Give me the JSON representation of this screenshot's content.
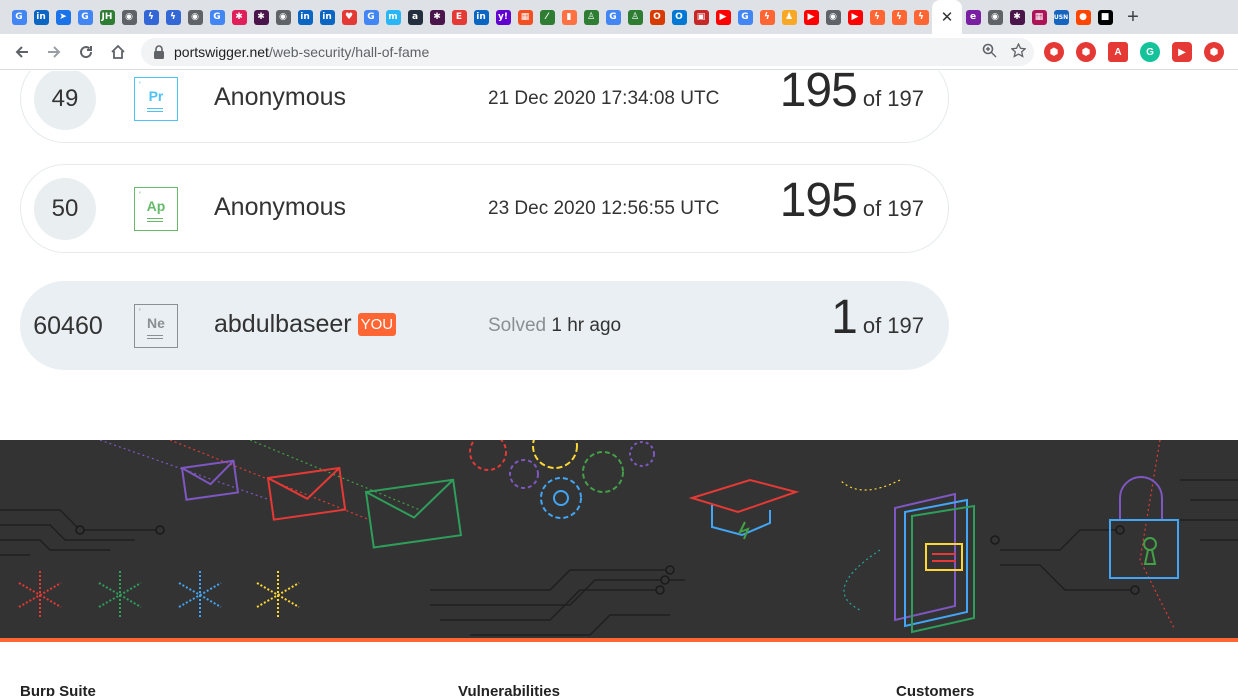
{
  "browser": {
    "favicons": [
      {
        "icon": "google-icon",
        "glyph": "G",
        "color": "#4285f4"
      },
      {
        "icon": "linkedin-icon",
        "glyph": "in",
        "color": "#0a66c2"
      },
      {
        "icon": "arrow-icon",
        "glyph": "➤",
        "color": "#1a73e8"
      },
      {
        "icon": "google-icon",
        "glyph": "G",
        "color": "#4285f4"
      },
      {
        "icon": "jh-icon",
        "glyph": "JH",
        "color": "#2e7d32"
      },
      {
        "icon": "globe-icon",
        "glyph": "◉",
        "color": "#5f6368"
      },
      {
        "icon": "zap-icon",
        "glyph": "ϟ",
        "color": "#3367d6"
      },
      {
        "icon": "zap-icon",
        "glyph": "ϟ",
        "color": "#3367d6"
      },
      {
        "icon": "globe-icon",
        "glyph": "◉",
        "color": "#5f6368"
      },
      {
        "icon": "google-icon",
        "glyph": "G",
        "color": "#4285f4"
      },
      {
        "icon": "slack-icon",
        "glyph": "✱",
        "color": "#e01e5a"
      },
      {
        "icon": "slack-icon",
        "glyph": "✱",
        "color": "#4a154b"
      },
      {
        "icon": "globe-icon",
        "glyph": "◉",
        "color": "#5f6368"
      },
      {
        "icon": "linkedin-icon",
        "glyph": "in",
        "color": "#0a66c2"
      },
      {
        "icon": "linkedin-icon",
        "glyph": "in",
        "color": "#0a66c2"
      },
      {
        "icon": "heart-icon",
        "glyph": "♥",
        "color": "#e53935"
      },
      {
        "icon": "google-icon",
        "glyph": "G",
        "color": "#4285f4"
      },
      {
        "icon": "m-icon",
        "glyph": "m",
        "color": "#29b6f6"
      },
      {
        "icon": "amazon-icon",
        "glyph": "a",
        "color": "#232f3e"
      },
      {
        "icon": "slack-icon",
        "glyph": "✱",
        "color": "#4a154b"
      },
      {
        "icon": "e-icon",
        "glyph": "E",
        "color": "#e53935"
      },
      {
        "icon": "linkedin-icon",
        "glyph": "in",
        "color": "#0a66c2"
      },
      {
        "icon": "yahoo-icon",
        "glyph": "y!",
        "color": "#6001d2"
      },
      {
        "icon": "windows-icon",
        "glyph": "▦",
        "color": "#f25022"
      },
      {
        "icon": "slash-icon",
        "glyph": "⁄",
        "color": "#2e7d32"
      },
      {
        "icon": "bookmark-icon",
        "glyph": "▮",
        "color": "#ff7043"
      },
      {
        "icon": "person-icon",
        "glyph": "♙",
        "color": "#2e7d32"
      },
      {
        "icon": "google-icon",
        "glyph": "G",
        "color": "#4285f4"
      },
      {
        "icon": "person-icon",
        "glyph": "♙",
        "color": "#2e7d32"
      },
      {
        "icon": "office-icon",
        "glyph": "O",
        "color": "#d83b01"
      },
      {
        "icon": "outlook-icon",
        "glyph": "O",
        "color": "#0078d4"
      },
      {
        "icon": "box-icon",
        "glyph": "▣",
        "color": "#c62828"
      },
      {
        "icon": "youtube-icon",
        "glyph": "▶",
        "color": "#ff0000"
      },
      {
        "icon": "google-icon",
        "glyph": "G",
        "color": "#4285f4"
      },
      {
        "icon": "burp-icon",
        "glyph": "ϟ",
        "color": "#ff6633"
      },
      {
        "icon": "user-icon",
        "glyph": "♟",
        "color": "#f9a825"
      },
      {
        "icon": "youtube-icon",
        "glyph": "▶",
        "color": "#ff0000"
      },
      {
        "icon": "globe-icon",
        "glyph": "◉",
        "color": "#5f6368"
      },
      {
        "icon": "youtube-icon",
        "glyph": "▶",
        "color": "#ff0000"
      },
      {
        "icon": "burp-icon",
        "glyph": "ϟ",
        "color": "#ff6633"
      },
      {
        "icon": "burp-icon",
        "glyph": "ϟ",
        "color": "#ff6633"
      },
      {
        "icon": "burp-icon",
        "glyph": "ϟ",
        "color": "#ff6633"
      }
    ],
    "active_tab_close": "✕",
    "favicons_after": [
      {
        "icon": "e-icon",
        "glyph": "e",
        "color": "#7b1fa2"
      },
      {
        "icon": "globe-icon",
        "glyph": "◉",
        "color": "#5f6368"
      },
      {
        "icon": "slack-icon",
        "glyph": "✱",
        "color": "#4a154b"
      },
      {
        "icon": "grid-icon",
        "glyph": "▦",
        "color": "#ad1457"
      },
      {
        "icon": "usn-icon",
        "glyph": "USN",
        "color": "#1565c0"
      },
      {
        "icon": "reddit-icon",
        "glyph": "●",
        "color": "#ff4500"
      },
      {
        "icon": "square-icon",
        "glyph": "■",
        "color": "#000000"
      }
    ],
    "new_tab": "+",
    "url_host": "portswigger.net",
    "url_path": "/web-security/hall-of-fame"
  },
  "leaderboard": [
    {
      "rank": "49",
      "element": "Pr",
      "element_color": "#4fc3f7",
      "name": "Anonymous",
      "you_badge": "",
      "solved_label": "",
      "time": "21 Dec 2020 17:34:08 UTC",
      "score": "195",
      "of_total": "of 197"
    },
    {
      "rank": "50",
      "element": "Ap",
      "element_color": "#66bb6a",
      "name": "Anonymous",
      "you_badge": "",
      "solved_label": "",
      "time": "23 Dec 2020 12:56:55 UTC",
      "score": "195",
      "of_total": "of 197"
    },
    {
      "rank": "60460",
      "element": "Ne",
      "element_color": "#8a8f94",
      "name": "abdulbaseer",
      "you_badge": "YOU",
      "solved_label": "Solved",
      "time": "1 hr ago",
      "score": "1",
      "of_total": "of 197"
    }
  ],
  "footer": {
    "col1": "Burp Suite",
    "col2": "Vulnerabilities",
    "col3": "Customers"
  },
  "colors": {
    "accent": "#ff6633",
    "banner_bg": "#333333"
  }
}
